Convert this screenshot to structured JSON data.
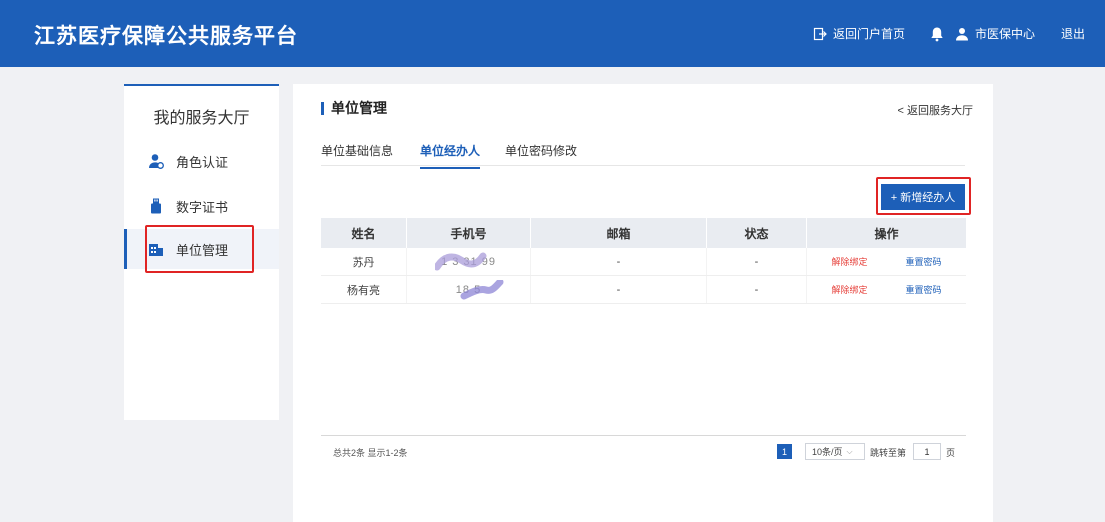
{
  "header": {
    "title": "江苏医疗保障公共服务平台",
    "portal_link": "返回门户首页",
    "user": "市医保中心",
    "logout": "退出"
  },
  "sidebar": {
    "title": "我的服务大厅",
    "items": [
      {
        "label": "角色认证",
        "icon": "user-badge-icon"
      },
      {
        "label": "数字证书",
        "icon": "usb-key-icon"
      },
      {
        "label": "单位管理",
        "icon": "building-icon",
        "active": true
      }
    ]
  },
  "main": {
    "title": "单位管理",
    "back_link": "< 返回服务大厅",
    "tabs": [
      {
        "label": "单位基础信息"
      },
      {
        "label": "单位经办人",
        "active": true
      },
      {
        "label": "单位密码修改"
      }
    ],
    "add_button": "+ 新增经办人",
    "table": {
      "headers": [
        "姓名",
        "手机号",
        "邮箱",
        "状态",
        "操作"
      ],
      "rows": [
        {
          "name": "苏丹",
          "phone": "1  3  31   99",
          "email": "-",
          "status": "-",
          "unbind": "解除绑定",
          "reset": "重置密码"
        },
        {
          "name": "杨有亮",
          "phone": "18        5",
          "email": "-",
          "status": "-",
          "unbind": "解除绑定",
          "reset": "重置密码"
        }
      ]
    },
    "pagination": {
      "total_text": "总共2条 显示1-2条",
      "current_page": "1",
      "page_size": "10条/页",
      "jump_label": "跳转至第",
      "jump_value": "1",
      "page_unit": "页"
    }
  },
  "colors": {
    "primary": "#1d5fb8",
    "danger": "#e6413b",
    "highlight": "#e02424"
  }
}
